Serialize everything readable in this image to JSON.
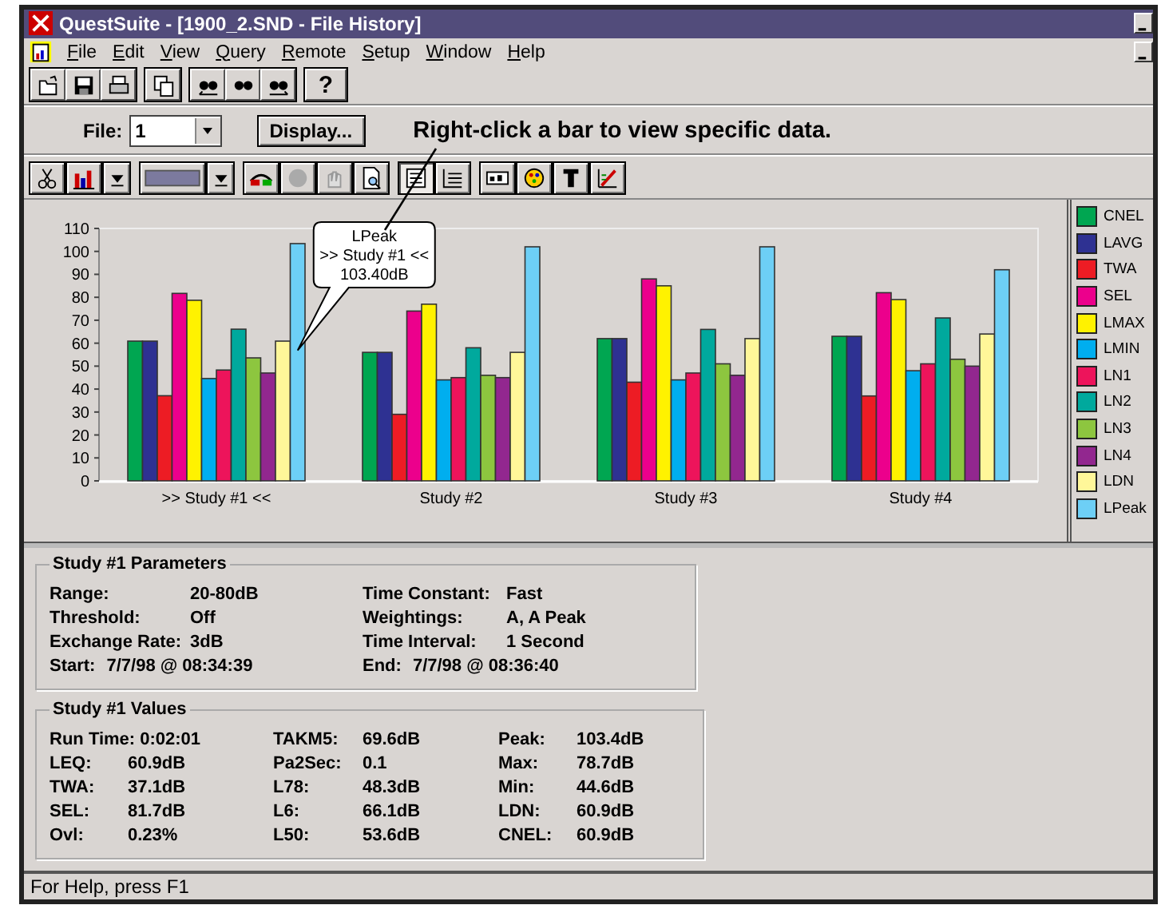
{
  "window": {
    "title": "QuestSuite - [1900_2.SND - File History]"
  },
  "menu": [
    "File",
    "Edit",
    "View",
    "Query",
    "Remote",
    "Setup",
    "Window",
    "Help"
  ],
  "help_button": "?",
  "file_selector": {
    "label": "File:",
    "value": "1"
  },
  "display_button": "Display...",
  "annotation": "Right-click a bar to view specific data.",
  "legend_toggle": {
    "on": true
  },
  "chart": {
    "chart_data": {
      "type": "bar",
      "categories": [
        ">> Study #1 <<",
        "Study #2",
        "Study #3",
        "Study #4"
      ],
      "series": [
        {
          "name": "CNEL",
          "color": "#00a651",
          "values": [
            60.9,
            56,
            62,
            63
          ]
        },
        {
          "name": "LAVG",
          "color": "#2e3192",
          "values": [
            60.9,
            56,
            62,
            63
          ]
        },
        {
          "name": "TWA",
          "color": "#ed1c24",
          "values": [
            37.1,
            29,
            43,
            37
          ]
        },
        {
          "name": "SEL",
          "color": "#ec008c",
          "values": [
            81.7,
            74,
            88,
            82
          ]
        },
        {
          "name": "LMAX",
          "color": "#fff200",
          "values": [
            78.7,
            77,
            85,
            79
          ]
        },
        {
          "name": "LMIN",
          "color": "#00aeef",
          "values": [
            44.6,
            44,
            44,
            48
          ]
        },
        {
          "name": "LN1",
          "color": "#ed145b",
          "values": [
            48.3,
            45,
            47,
            51
          ]
        },
        {
          "name": "LN2",
          "color": "#00a99d",
          "values": [
            66.1,
            58,
            66,
            71
          ]
        },
        {
          "name": "LN3",
          "color": "#8dc63f",
          "values": [
            53.6,
            46,
            51,
            53
          ]
        },
        {
          "name": "LN4",
          "color": "#92278f",
          "values": [
            47,
            45,
            46,
            50
          ]
        },
        {
          "name": "LDN",
          "color": "#fff799",
          "values": [
            60.9,
            56,
            62,
            64
          ]
        },
        {
          "name": "LPeak",
          "color": "#6dcff6",
          "values": [
            103.4,
            102,
            102,
            92
          ]
        }
      ],
      "ylim": [
        0,
        110
      ],
      "yticks": [
        0,
        10,
        20,
        30,
        40,
        50,
        60,
        70,
        80,
        90,
        100,
        110
      ]
    },
    "tooltip": {
      "series": "LPeak",
      "category": ">> Study #1 <<",
      "value": "103.40dB"
    }
  },
  "parameters": {
    "title": "Study #1 Parameters",
    "items": [
      {
        "label": "Range:",
        "value": "20-80dB",
        "kind": "column"
      },
      {
        "label": "Time Constant:",
        "value": "Fast",
        "kind": "column"
      },
      {
        "label": "Threshold:",
        "value": "Off",
        "kind": "column"
      },
      {
        "label": "Weightings:",
        "value": "A, A Peak",
        "kind": "column"
      },
      {
        "label": "Exchange Rate:",
        "value": "3dB",
        "kind": "column"
      },
      {
        "label": "Time Interval:",
        "value": "1 Second",
        "kind": "column"
      },
      {
        "label": "Start:",
        "value": "7/7/98 @ 08:34:39",
        "kind": "inline"
      },
      {
        "label": "End:",
        "value": "7/7/98 @ 08:36:40",
        "kind": "inline"
      }
    ]
  },
  "values": {
    "title": "Study #1 Values",
    "items": [
      {
        "label": "Run Time:",
        "value": "0:02:01"
      },
      {
        "label": "TAKM5:",
        "value": "69.6dB"
      },
      {
        "label": "Peak:",
        "value": "103.4dB"
      },
      {
        "label": "LEQ:",
        "value": "60.9dB"
      },
      {
        "label": "Pa2Sec:",
        "value": "0.1"
      },
      {
        "label": "Max:",
        "value": "78.7dB"
      },
      {
        "label": "TWA:",
        "value": "37.1dB"
      },
      {
        "label": "L78:",
        "value": "48.3dB"
      },
      {
        "label": "Min:",
        "value": "44.6dB"
      },
      {
        "label": "SEL:",
        "value": "81.7dB"
      },
      {
        "label": "L6:",
        "value": "66.1dB"
      },
      {
        "label": "LDN:",
        "value": "60.9dB"
      },
      {
        "label": "Ovl:",
        "value": "0.23%"
      },
      {
        "label": "L50:",
        "value": "53.6dB"
      },
      {
        "label": "CNEL:",
        "value": "60.9dB"
      }
    ]
  },
  "status_bar": "For Help, press F1"
}
